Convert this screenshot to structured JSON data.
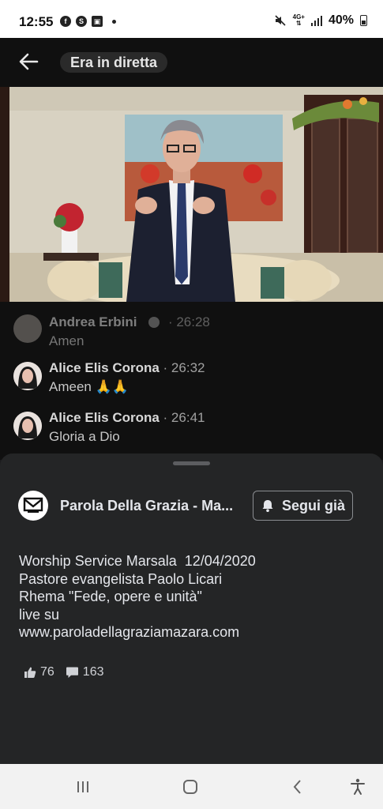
{
  "status_bar": {
    "time": "12:55",
    "network": [
      "4G+",
      "LTE"
    ],
    "battery": "40%"
  },
  "header": {
    "back_icon": "arrow-left-icon",
    "live_label": "Era in diretta"
  },
  "comments": [
    {
      "author": "Andrea Erbini",
      "time": "· 26:28",
      "text": "Amen"
    },
    {
      "author": "Alice Elis Corona",
      "time": " · 26:32",
      "text": "Ameen 🙏🙏"
    },
    {
      "author": "Alice Elis Corona",
      "time": " · 26:41",
      "text": "Gloria a Dio"
    }
  ],
  "post": {
    "page_name": "Parola Della Grazia - Ma...",
    "follow_label": "Segui già",
    "description_lines": [
      "Worship Service Marsala  12/04/2020",
      "Pastore evangelista Paolo Licari",
      "Rhema \"Fede, opere e unità\"",
      "live su",
      "www.paroladellagraziamazara.com"
    ],
    "likes": "76",
    "comments_count": "163"
  },
  "colors": {
    "sheet_bg": "#242526",
    "dark_bg": "#101010",
    "text_primary": "#e4e6eb"
  }
}
